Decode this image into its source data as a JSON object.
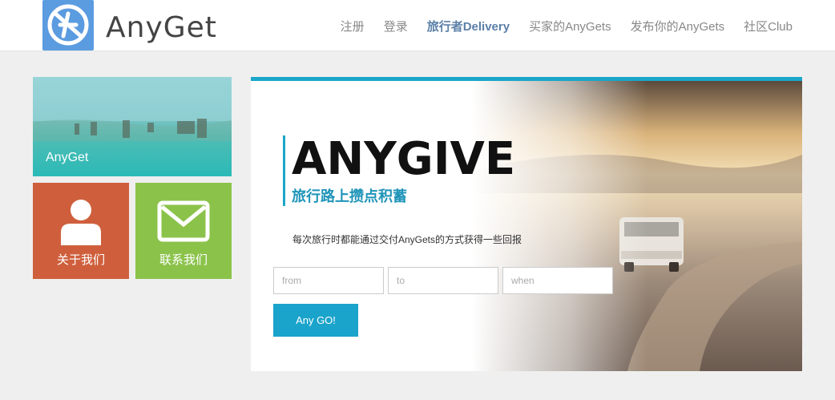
{
  "brand": {
    "name": "AnyGet"
  },
  "nav": {
    "items": [
      "注册",
      "登录",
      "旅行者Delivery",
      "买家的AnyGets",
      "发布你的AnyGets",
      "社区Club"
    ],
    "active_index": 2
  },
  "tiles": {
    "banner_label": "AnyGet",
    "about_label": "关于我们",
    "contact_label": "联系我们"
  },
  "hero": {
    "title": "ANYGIVE",
    "subtitle": "旅行路上攒点积蓄",
    "description": "每次旅行时都能通过交付AnyGets的方式获得一些回报",
    "from_placeholder": "from",
    "to_placeholder": "to",
    "when_placeholder": "when",
    "button_label": "Any GO!"
  },
  "colors": {
    "accent": "#1aa6c8",
    "about_tile": "#cf5f3c",
    "contact_tile": "#8bc34a",
    "nav_active": "#5b7fa8"
  }
}
